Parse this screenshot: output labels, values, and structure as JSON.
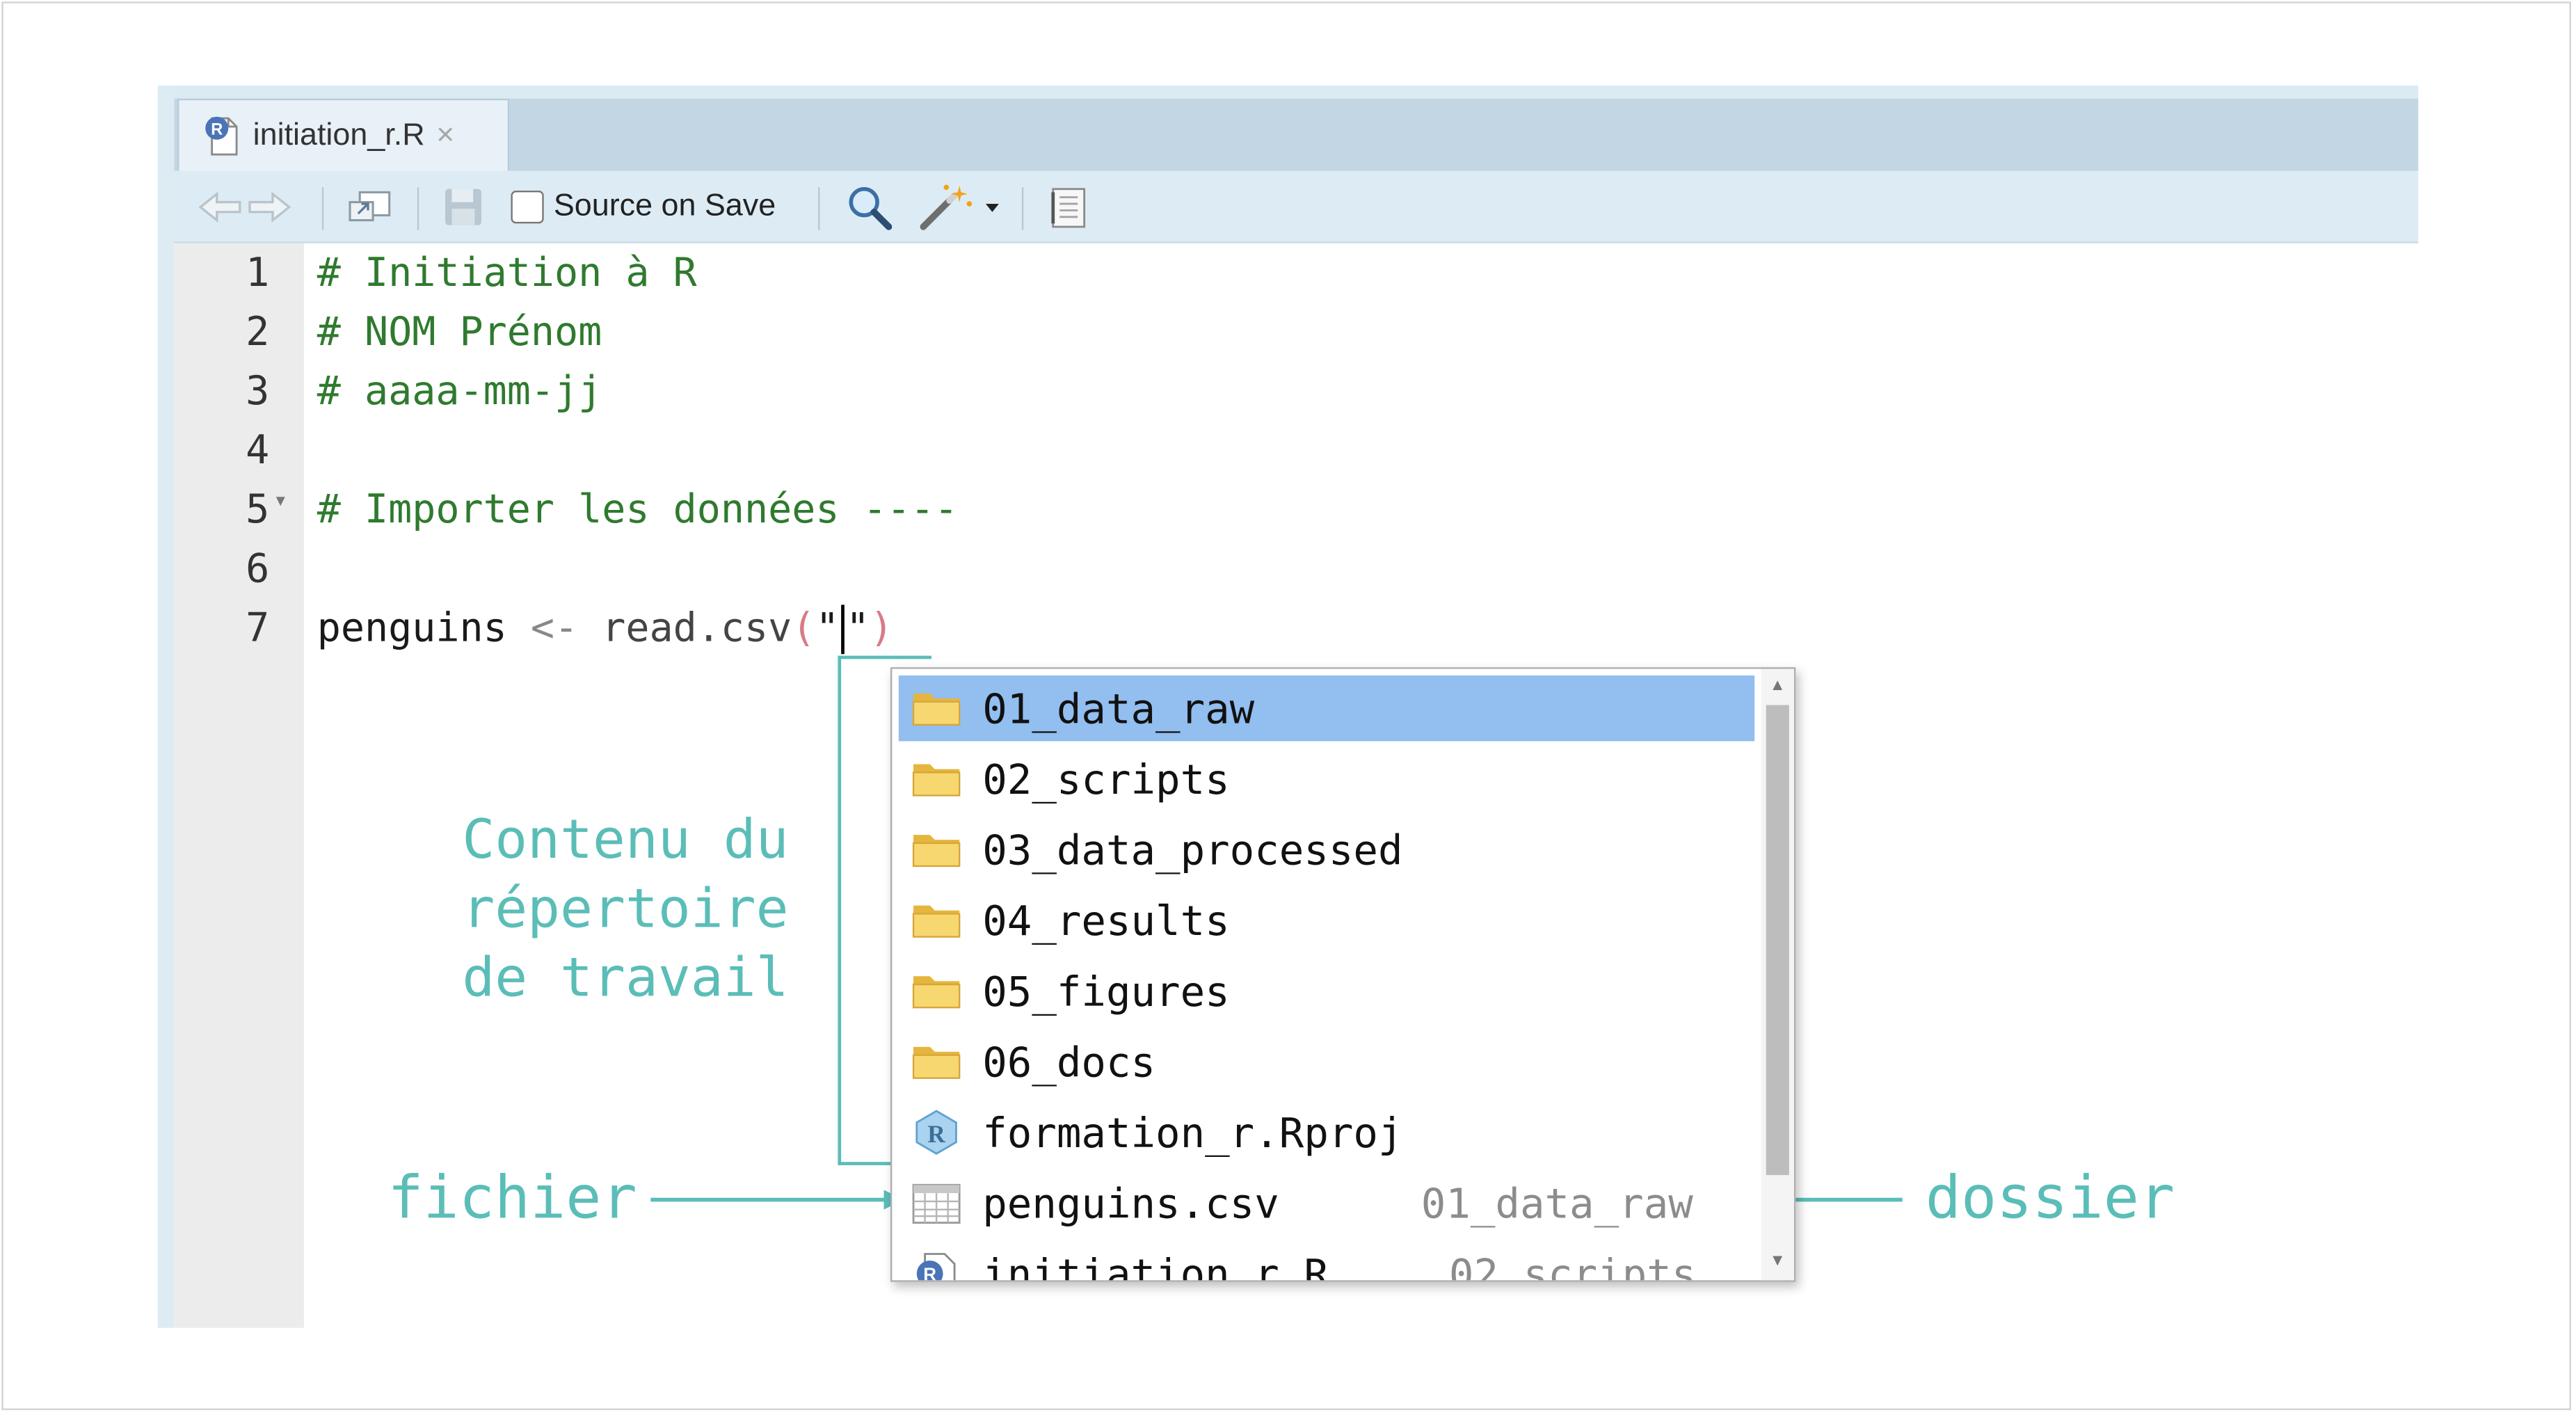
{
  "editor": {
    "tab": {
      "filename": "initiation_r.R",
      "close_glyph": "×",
      "file_icon": "r-script-icon"
    },
    "toolbar": {
      "source_on_save_label": "Source on Save",
      "source_on_save_checked": false,
      "icons": [
        "back-arrow-icon",
        "forward-arrow-icon",
        "show-in-window-icon",
        "save-icon",
        "search-icon",
        "code-tools-wand-icon",
        "dropdown-caret-icon",
        "compile-report-icon"
      ]
    },
    "lines": [
      {
        "num": "1",
        "text": "# Initiation à R"
      },
      {
        "num": "2",
        "text": "# NOM Prénom"
      },
      {
        "num": "3",
        "text": "# aaaa-mm-jj"
      },
      {
        "num": "4",
        "text": ""
      },
      {
        "num": "5",
        "text": "# Importer les données ----",
        "foldable": true
      },
      {
        "num": "6",
        "text": ""
      },
      {
        "num": "7",
        "id": "penguins",
        "op": "<-",
        "fn": "read.csv",
        "open_paren": "(",
        "quote_open": "\"",
        "quote_close": "\"",
        "close_paren": ")"
      }
    ]
  },
  "autocomplete": {
    "items": [
      {
        "name": "01_data_raw",
        "type": "folder",
        "selected": true
      },
      {
        "name": "02_scripts",
        "type": "folder"
      },
      {
        "name": "03_data_processed",
        "type": "folder"
      },
      {
        "name": "04_results",
        "type": "folder"
      },
      {
        "name": "05_figures",
        "type": "folder"
      },
      {
        "name": "06_docs",
        "type": "folder"
      },
      {
        "name": "formation_r.Rproj",
        "type": "rproj"
      },
      {
        "name": "penguins.csv",
        "type": "csv",
        "location": "01_data_raw"
      },
      {
        "name": "initiation_r.R",
        "type": "rscript",
        "location": "02_scripts"
      }
    ]
  },
  "annotations": {
    "working_dir_lines": [
      "Contenu du",
      "répertoire",
      "de travail"
    ],
    "file_label": "fichier",
    "folder_label": "dossier",
    "color": "#5bbdb8"
  },
  "colors": {
    "selection": "#92bef0",
    "comment": "#2f7a2f",
    "paren": "#d87b86"
  }
}
